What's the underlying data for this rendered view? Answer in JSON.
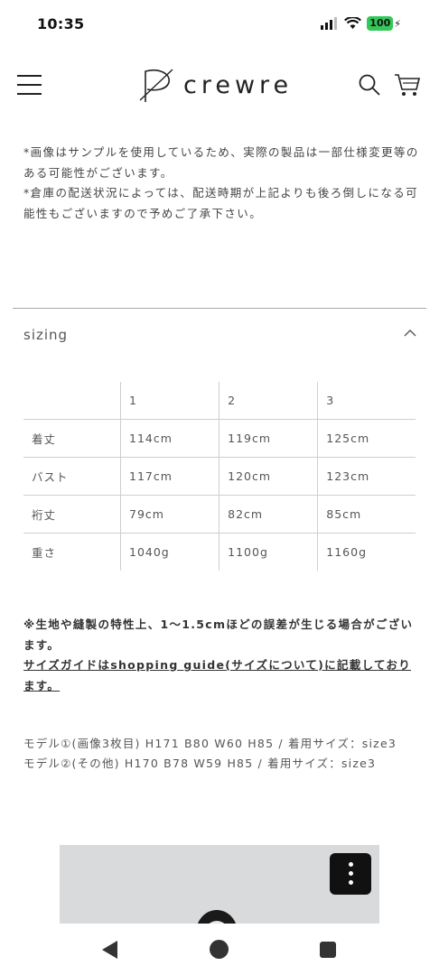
{
  "status_bar": {
    "time": "10:35",
    "battery": "100"
  },
  "header": {
    "logo_text": "crewre"
  },
  "notes": [
    "*画像はサンプルを使用しているため、実際の製品は一部仕様変更等のある可能性がございます。",
    "*倉庫の配送状況によっては、配送時期が上記よりも後ろ倒しになる可能性もございますので予めご了承下さい。"
  ],
  "sizing": {
    "title": "sizing",
    "columns": [
      "",
      "1",
      "2",
      "3"
    ],
    "rows": [
      [
        "着丈",
        "114cm",
        "119cm",
        "125cm"
      ],
      [
        "バスト",
        "117cm",
        "120cm",
        "123cm"
      ],
      [
        "裄丈",
        "79cm",
        "82cm",
        "85cm"
      ],
      [
        "重さ",
        "1040g",
        "1100g",
        "1160g"
      ]
    ]
  },
  "warning": "※生地や縫製の特性上、1〜1.5cmほどの誤差が生じる場合がございます。",
  "guide_link": "サイズガイドはshopping guide(サイズについて)に記載しております。",
  "models": [
    "モデル①(画像3枚目) H171 B80 W60 H85 / 着用サイズ：size3",
    "モデル②(その他) H170 B78 W59 H85 / 着用サイズ：size3"
  ]
}
